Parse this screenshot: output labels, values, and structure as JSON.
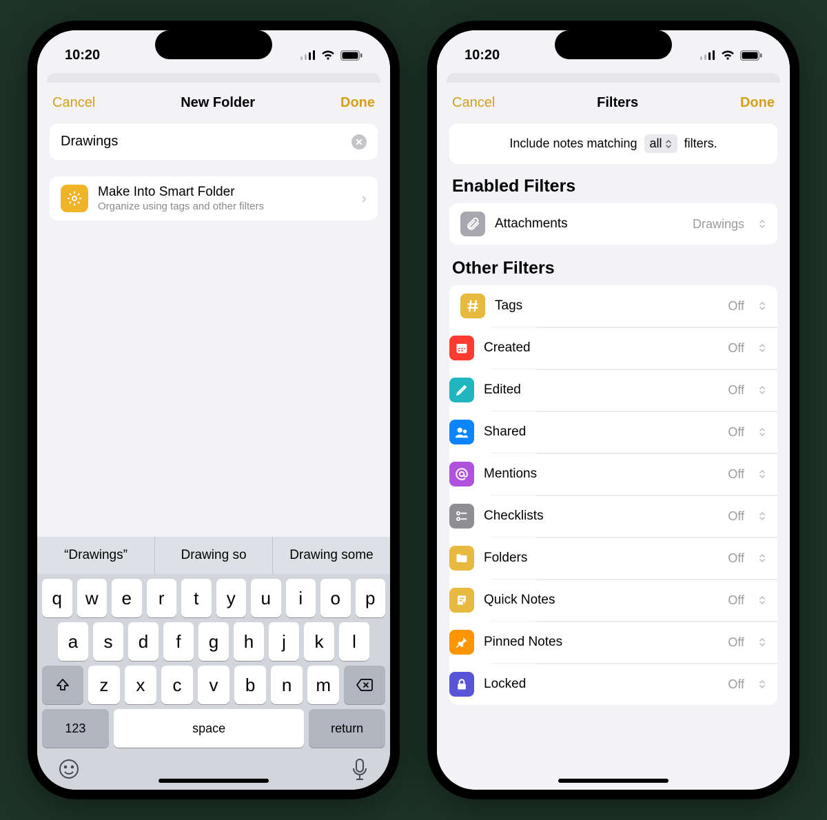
{
  "status": {
    "time": "10:20"
  },
  "left_screen": {
    "cancel": "Cancel",
    "done": "Done",
    "title": "New Folder",
    "folder_name": "Drawings",
    "smart_title": "Make Into Smart Folder",
    "smart_sub": "Organize using tags and other filters",
    "suggestions": [
      "“Drawings”",
      "Drawing so",
      "Drawing some"
    ],
    "keys_row1": [
      "q",
      "w",
      "e",
      "r",
      "t",
      "y",
      "u",
      "i",
      "o",
      "p"
    ],
    "keys_row2": [
      "a",
      "s",
      "d",
      "f",
      "g",
      "h",
      "j",
      "k",
      "l"
    ],
    "keys_row3": [
      "z",
      "x",
      "c",
      "v",
      "b",
      "n",
      "m"
    ],
    "num_key": "123",
    "space_key": "space",
    "return_key": "return"
  },
  "right_screen": {
    "cancel": "Cancel",
    "done": "Done",
    "title": "Filters",
    "include_prefix": "Include notes matching",
    "include_chip": "all",
    "include_suffix": "filters.",
    "enabled_header": "Enabled Filters",
    "other_header": "Other Filters",
    "enabled": {
      "label": "Attachments",
      "value": "Drawings",
      "icon": "attach",
      "color": "#a7a7ad"
    },
    "other": [
      {
        "label": "Tags",
        "value": "Off",
        "icon": "hash",
        "color": "#e7b93e"
      },
      {
        "label": "Created",
        "value": "Off",
        "icon": "calendar",
        "color": "#ff3b30"
      },
      {
        "label": "Edited",
        "value": "Off",
        "icon": "pencil",
        "color": "#1fb6c0"
      },
      {
        "label": "Shared",
        "value": "Off",
        "icon": "shared",
        "color": "#0a84ff"
      },
      {
        "label": "Mentions",
        "value": "Off",
        "icon": "at",
        "color": "#af52de"
      },
      {
        "label": "Checklists",
        "value": "Off",
        "icon": "check",
        "color": "#8e8e93"
      },
      {
        "label": "Folders",
        "value": "Off",
        "icon": "folder",
        "color": "#e7b93e"
      },
      {
        "label": "Quick Notes",
        "value": "Off",
        "icon": "quick",
        "color": "#e7b93e"
      },
      {
        "label": "Pinned Notes",
        "value": "Off",
        "icon": "pin",
        "color": "#ff9500"
      },
      {
        "label": "Locked",
        "value": "Off",
        "icon": "lock",
        "color": "#5856d6"
      }
    ]
  }
}
